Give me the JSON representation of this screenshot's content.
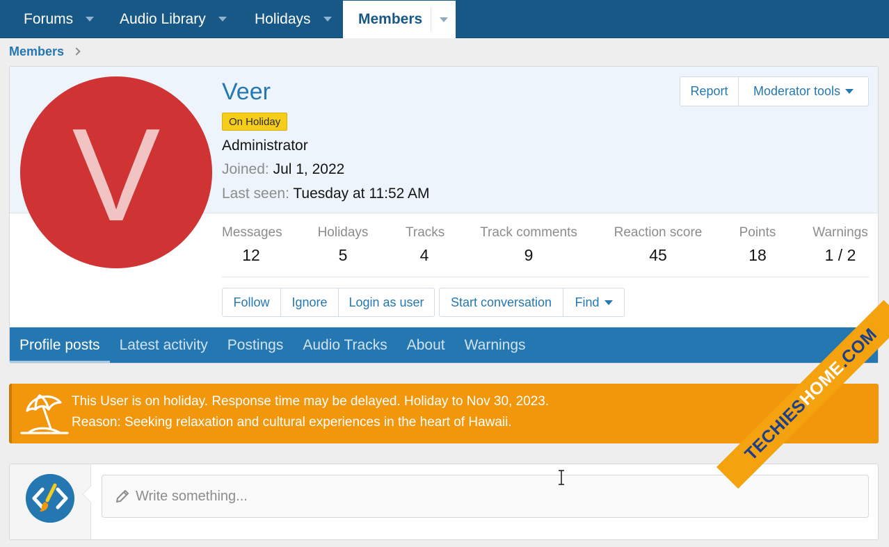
{
  "topnav": {
    "tabs": [
      {
        "label": "Forums"
      },
      {
        "label": "Audio Library"
      },
      {
        "label": "Holidays"
      },
      {
        "label": "Members",
        "active": true
      }
    ]
  },
  "breadcrumb": {
    "label": "Members"
  },
  "profile": {
    "avatar_letter": "V",
    "username": "Veer",
    "badge": "On Holiday",
    "role": "Administrator",
    "joined_label": "Joined:",
    "joined_value": "Jul 1, 2022",
    "last_seen_label": "Last seen:",
    "last_seen_value": "Tuesday at 11:52 AM",
    "report_label": "Report",
    "moderator_tools_label": "Moderator tools",
    "stats": [
      {
        "label": "Messages",
        "value": "12"
      },
      {
        "label": "Holidays",
        "value": "5"
      },
      {
        "label": "Tracks",
        "value": "4"
      },
      {
        "label": "Track comments",
        "value": "9"
      },
      {
        "label": "Reaction score",
        "value": "45"
      },
      {
        "label": "Points",
        "value": "18"
      },
      {
        "label": "Warnings",
        "value": "1 / 2"
      }
    ],
    "actions": {
      "follow": "Follow",
      "ignore": "Ignore",
      "login_as_user": "Login as user",
      "start_conversation": "Start conversation",
      "find": "Find"
    },
    "tabs": [
      {
        "label": "Profile posts",
        "active": true
      },
      {
        "label": "Latest activity"
      },
      {
        "label": "Postings"
      },
      {
        "label": "Audio Tracks"
      },
      {
        "label": "About"
      },
      {
        "label": "Warnings"
      }
    ]
  },
  "notice": {
    "line1": "This User is on holiday. Response time may be delayed. Holiday to Nov 30, 2023.",
    "line2": "Reason: Seeking relaxation and cultural experiences in the heart of Hawaii."
  },
  "composer": {
    "placeholder": "Write something..."
  },
  "watermark": {
    "part1": "TECHIES",
    "part2": "HOME",
    "part3": ".COM"
  },
  "colors": {
    "nav_bg": "#185886",
    "accent": "#2577b1",
    "badge": "#f7cd1c",
    "notice": "#f2960c",
    "avatar": "#cf3333"
  }
}
